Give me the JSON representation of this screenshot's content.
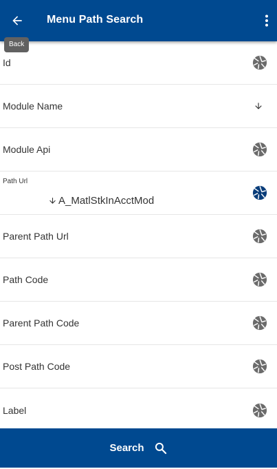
{
  "header": {
    "title": "Menu Path Search",
    "back_icon": "arrow-left-icon",
    "more_icon": "more-vertical-icon",
    "bg_color": "#004990"
  },
  "tooltip": {
    "text": "Back"
  },
  "fields": [
    {
      "label": "Id",
      "icon": "aperture-icon"
    },
    {
      "label": "Module Name",
      "icon": "sort-down-icon"
    },
    {
      "label": "Module Api",
      "icon": "aperture-icon"
    },
    {
      "label": "Path Url",
      "value": "A_MatlStkInAcctMod",
      "icon": "aperture-icon",
      "icon_color": "#004990"
    },
    {
      "label": "Parent Path Url",
      "icon": "aperture-icon"
    },
    {
      "label": "Path Code",
      "icon": "aperture-icon"
    },
    {
      "label": "Parent Path Code",
      "icon": "aperture-icon"
    },
    {
      "label": "Post Path Code",
      "icon": "aperture-icon"
    },
    {
      "label": "Label",
      "icon": "aperture-icon"
    }
  ],
  "search_button": {
    "label": "Search",
    "icon": "search-icon"
  }
}
